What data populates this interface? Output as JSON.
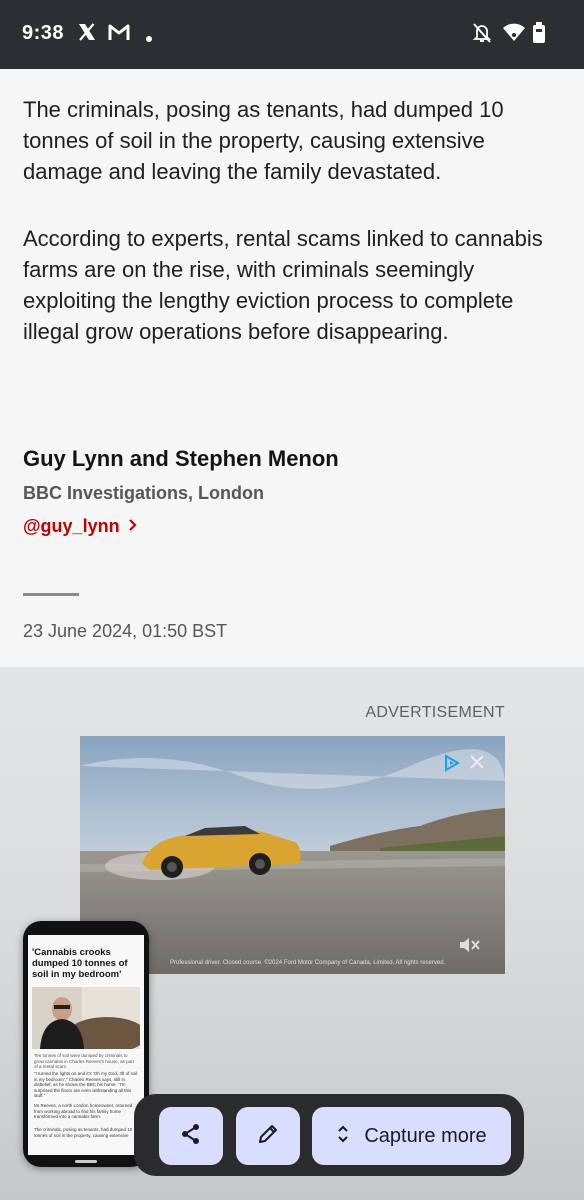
{
  "status_bar": {
    "time": "9:38",
    "left_icons": [
      "x-logo-icon",
      "gmail-icon",
      "dot-icon"
    ],
    "right_icons": [
      "bell-off-icon",
      "wifi-icon",
      "battery-icon"
    ]
  },
  "article": {
    "para1": "The criminals, posing as tenants, had dumped 10 tonnes of soil in the property, causing extensive damage and leaving the family devastated.",
    "para2": "According to experts, rental scams linked to cannabis farms are on the rise, with criminals seemingly exploiting the lengthy eviction process to complete illegal grow operations before disappearing.",
    "author_name": "Guy Lynn and Stephen Menon",
    "author_org": "BBC Investigations, London",
    "author_handle": "@guy_lynn",
    "date": "23 June 2024, 01:50 BST"
  },
  "ad": {
    "label": "ADVERTISEMENT",
    "caption": "Professional driver. Closed course. ©2024 Ford Motor Company of Canada, Limited. All rights reserved."
  },
  "thumbnail": {
    "title": "'Cannabis crooks dumped 10 tonnes of soil in my bedroom'",
    "caption": "Ten tonnes of soil were dumped by criminals to grow cannabis in Charles Reeves's house, as part of a rental scam",
    "p1": "\"I turned the lights on and it's 'Oh my God, 3ft of soil in my bedroom',\" Charles Reeves says, still in disbelief, as he shows the BBC his home. \"I'm surprised the floors are even withstanding all this stuff.\"",
    "p2": "Mr Reeves, a north London homeowner, returned from working abroad to find his family home transformed into a cannabis farm.",
    "p3": "The criminals, posing as tenants, had dumped 10 tonnes of soil in the property, causing extensive"
  },
  "toolbar": {
    "share_icon": "share-icon",
    "edit_icon": "pencil-icon",
    "capture_more_label": "Capture more",
    "capture_icon": "expand-vertical-icon"
  },
  "colors": {
    "status_bar_bg": "#2d2e31",
    "link_red": "#b80000",
    "button_bg": "#d9defe",
    "toolbar_bg": "#2b2b2e"
  }
}
